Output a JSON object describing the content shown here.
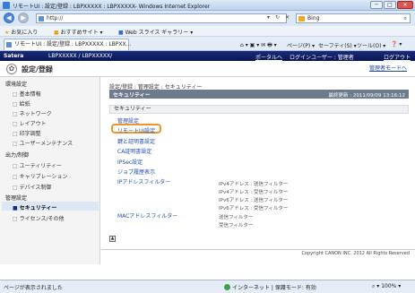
{
  "window": {
    "title": "リモートUI : 設定/登録 : LBPXXXXX : LBPXXXXX- Windows Internet Explorer",
    "min": "─",
    "max": "□",
    "close": "✕"
  },
  "address": {
    "back": "◀",
    "forward": "▶",
    "url": "http://",
    "search_placeholder": "Bing",
    "refresh": "↻",
    "stop": "✕",
    "dropdown": "▾"
  },
  "favorites": {
    "label": "お気に入り",
    "suggested": "おすすめサイト ▾",
    "slice": "Web スライス ギャラリー ▾"
  },
  "tab": {
    "label": "リモートUI : 設定/登録 : LBPXXXXX : LBPXX..."
  },
  "toolbar": {
    "items": [
      "ページ(P) ▾",
      "セーフティ(S) ▾",
      "ツール(O) ▾",
      "❓ ▾"
    ]
  },
  "satera": {
    "brand": "Satera",
    "device": "LBPXXXXX / LBPXXXXX/",
    "portal": "ポータルへ",
    "login": "ログインユーザー : 管理者",
    "logout": "ログアウト"
  },
  "header": {
    "title": "設定/登録",
    "admin_mode": "管理者モードへ"
  },
  "sidebar": {
    "env_title": "環境設定",
    "env_items": [
      "基本情報",
      "給紙",
      "ネットワーク",
      "レイアウト",
      "印字調整",
      "ユーザーメンテナンス"
    ],
    "io_title": "出力/制御",
    "io_items": [
      "ユーティリティー",
      "キャリブレーション",
      "デバイス制御"
    ],
    "mgmt_title": "管理設定",
    "mgmt_items": [
      "セキュリティー",
      "ライセンス/その他"
    ]
  },
  "main": {
    "breadcrumb": "設定/登録 : 管理設定 : セキュリティー",
    "page_title": "セキュリティー",
    "last_updated": "最終更新 : 2011/09/09 13:16:12",
    "section": "セキュリティー",
    "links": [
      "管理設定",
      "リモートUI設定",
      "鍵と証明書設定",
      "CA証明書設定",
      "IPSec設定",
      "ジョブ履歴表示",
      "IPアドレスフィルター",
      "MACアドレスフィルター"
    ],
    "ip_notes": [
      "IPv4アドレス : 送信フィルター",
      "IPv4アドレス : 受信フィルター",
      "IPv6アドレス : 送信フィルター",
      "IPv6アドレス : 受信フィルター"
    ],
    "mac_notes": [
      "送信フィルター",
      "受信フィルター"
    ],
    "top_button": "▲",
    "copyright": "Copyright CANON INC. 2012 All Rights Reserved"
  },
  "status": {
    "left": "ページが表示されました",
    "zone": "インターネット | 保護モード: 有効",
    "zoom": "100%"
  }
}
